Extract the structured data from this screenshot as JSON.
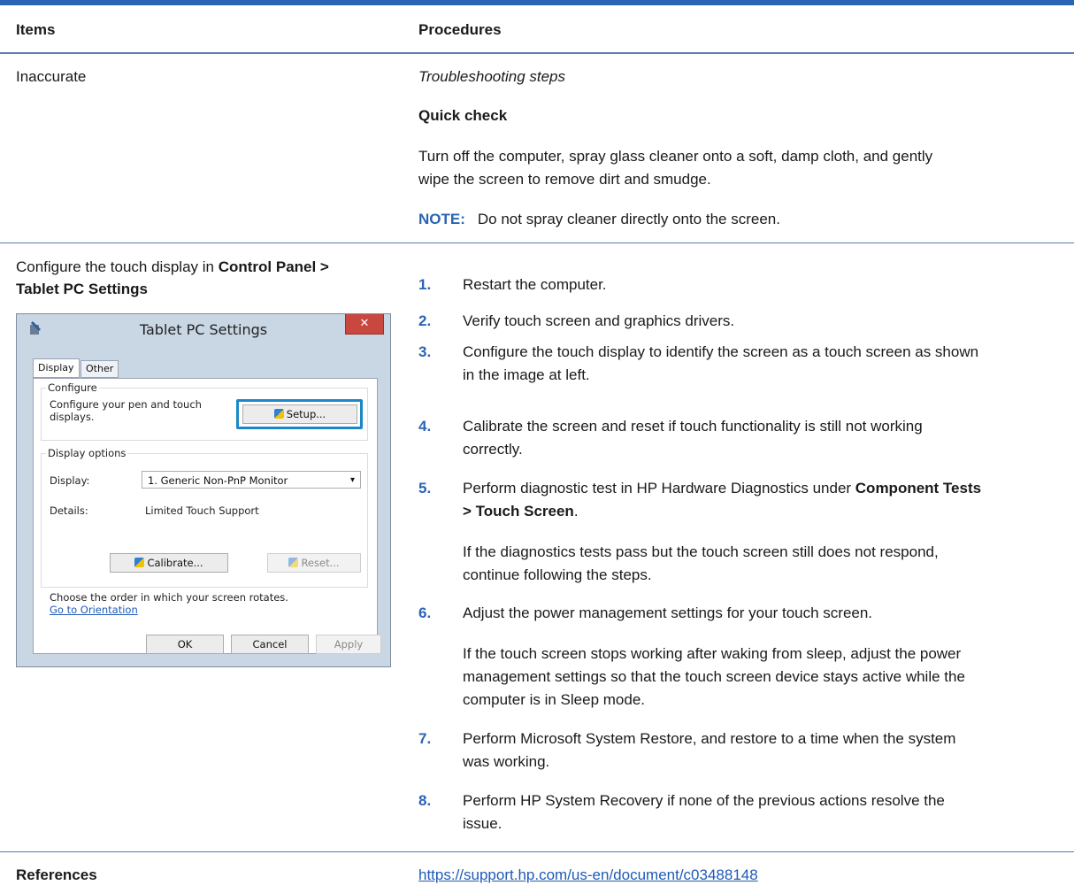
{
  "table": {
    "headers": {
      "items": "Items",
      "procedures": "Procedures"
    },
    "row1": {
      "item": "Inaccurate",
      "troubleshooting": "Troubleshooting steps",
      "quick_check": "Quick check",
      "paragraph_line1": "Turn off the computer, spray glass cleaner onto a soft, damp cloth, and gently",
      "paragraph_line2": "wipe the screen to remove dirt and smudge.",
      "note_label": "NOTE:",
      "note_text": "Do not spray cleaner directly onto the screen."
    },
    "row2": {
      "item_line1_text": "Configure the touch display in ",
      "item_line1_bold": "Control Panel >",
      "item_line2_bold": "Tablet PC Settings",
      "steps": [
        {
          "num": "1.",
          "lines": [
            "Restart the computer."
          ]
        },
        {
          "num": "2.",
          "lines": [
            "Verify touch screen and graphics drivers."
          ]
        },
        {
          "num": "3.",
          "lines": [
            "Configure the touch display to identify the screen as a touch screen as shown",
            "in the image at left."
          ]
        },
        {
          "num": "4.",
          "lines": [
            "Calibrate the screen and reset if touch functionality is still not working",
            "correctly."
          ]
        },
        {
          "num": "5.",
          "line1_text": "Perform diagnostic test in HP Hardware Diagnostics under ",
          "line1_bold": "Component Tests",
          "line2_bold": "> Touch Screen",
          "line2_tail": "."
        },
        {
          "num": "6.",
          "lines": [
            "Adjust the power management settings for your touch screen."
          ]
        },
        {
          "num": "7.",
          "lines": [
            "Perform Microsoft System Restore, and restore to a time when the system",
            "was working."
          ]
        },
        {
          "num": "8.",
          "lines": [
            "Perform HP System Recovery if none of the previous actions resolve the",
            "issue."
          ]
        }
      ],
      "step5_sub": [
        "If the diagnostics tests pass but the touch screen still does not respond,",
        "continue following the steps."
      ],
      "step6_sub": [
        "If the touch screen stops working after waking from sleep, adjust the power",
        "management settings so that the touch screen device stays active while the",
        "computer is in Sleep mode."
      ]
    },
    "row3": {
      "item": "References",
      "link": "https://support.hp.com/us-en/document/c03488148"
    }
  },
  "dialog": {
    "title": "Tablet PC Settings",
    "close": "✕",
    "tabs": [
      "Display",
      "Other"
    ],
    "configure_group": "Configure",
    "configure_text_line1": "Configure your pen and touch",
    "configure_text_line2": "displays.",
    "setup_button": "Setup...",
    "display_options_group": "Display options",
    "display_label": "Display:",
    "display_value": "1. Generic Non-PnP Monitor",
    "details_label": "Details:",
    "details_value": "Limited Touch Support",
    "calibrate_button": "Calibrate...",
    "reset_button": "Reset...",
    "rotation_text": "Choose the order in which your screen rotates.",
    "orientation_link": "Go to Orientation",
    "ok_button": "OK",
    "cancel_button": "Cancel",
    "apply_button": "Apply"
  },
  "colors": {
    "accent": "#2b63b5",
    "rule": "#5a7bb0",
    "link": "#1f5ab8"
  }
}
